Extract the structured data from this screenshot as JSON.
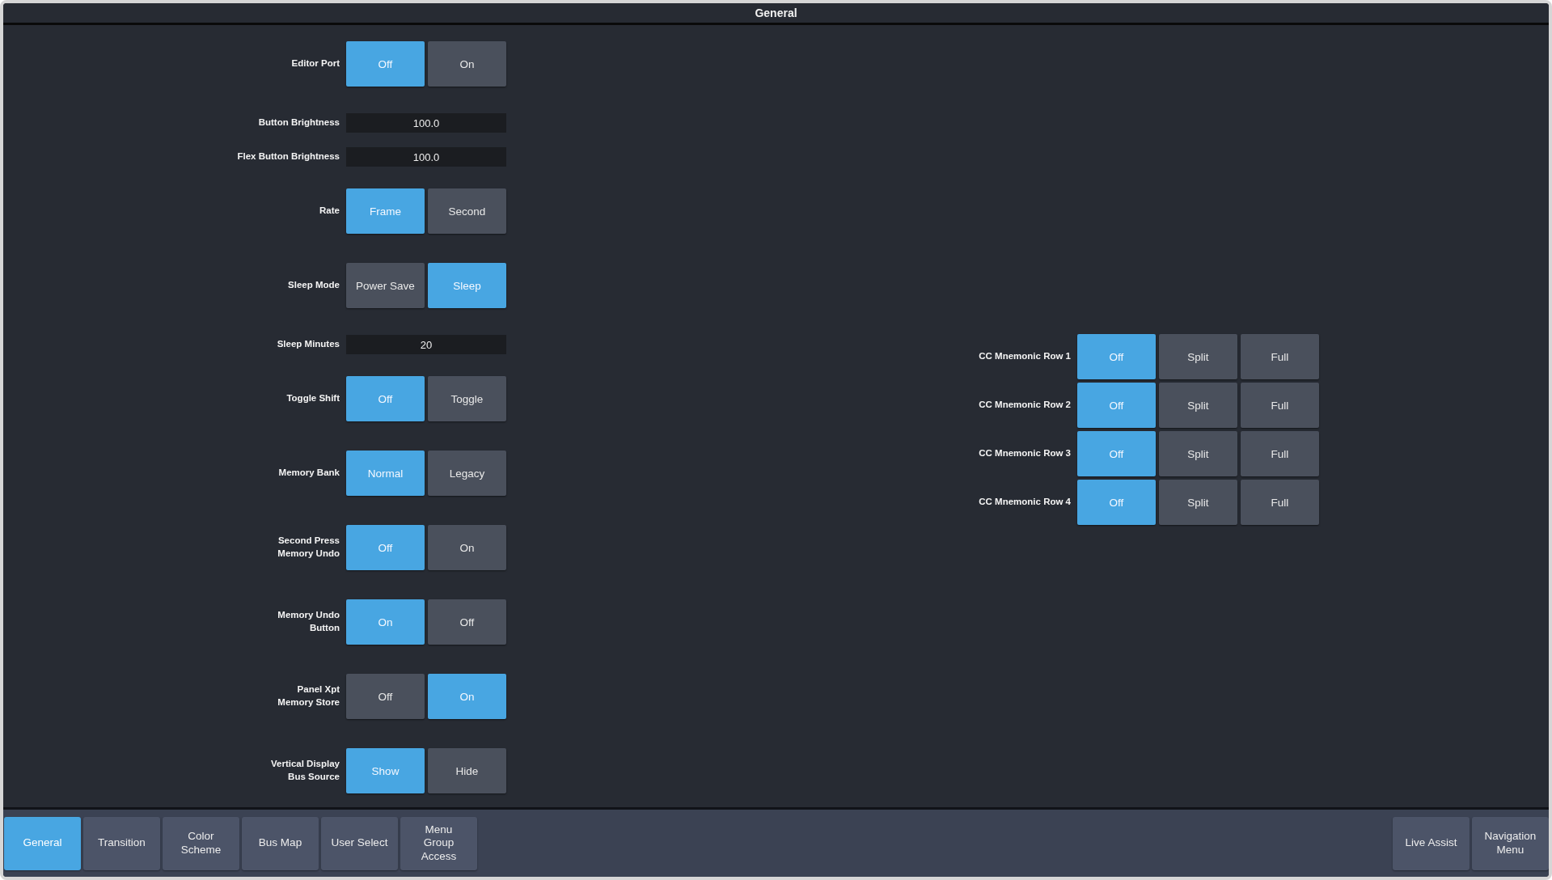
{
  "window": {
    "title": "General"
  },
  "settings": [
    {
      "kind": "toggle",
      "label": "Editor Port",
      "options": [
        {
          "label": "Off",
          "selected": true
        },
        {
          "label": "On",
          "selected": false
        }
      ]
    },
    {
      "kind": "field",
      "label": "Button Brightness",
      "value": "100.0"
    },
    {
      "kind": "field",
      "label": "Flex Button Brightness",
      "value": "100.0"
    },
    {
      "kind": "toggle",
      "label": "Rate",
      "options": [
        {
          "label": "Frame",
          "selected": true
        },
        {
          "label": "Second",
          "selected": false
        }
      ]
    },
    {
      "kind": "toggle",
      "label": "Sleep Mode",
      "options": [
        {
          "label": "Power Save",
          "selected": false
        },
        {
          "label": "Sleep",
          "selected": true
        }
      ]
    },
    {
      "kind": "field",
      "label": "Sleep Minutes",
      "value": "20"
    },
    {
      "kind": "toggle",
      "label": "Toggle Shift",
      "options": [
        {
          "label": "Off",
          "selected": true
        },
        {
          "label": "Toggle",
          "selected": false
        }
      ]
    },
    {
      "kind": "toggle",
      "label": "Memory Bank",
      "options": [
        {
          "label": "Normal",
          "selected": true
        },
        {
          "label": "Legacy",
          "selected": false
        }
      ]
    },
    {
      "kind": "toggle",
      "label": "Second Press\nMemory Undo",
      "options": [
        {
          "label": "Off",
          "selected": true
        },
        {
          "label": "On",
          "selected": false
        }
      ]
    },
    {
      "kind": "toggle",
      "label": "Memory Undo\nButton",
      "options": [
        {
          "label": "On",
          "selected": true
        },
        {
          "label": "Off",
          "selected": false
        }
      ]
    },
    {
      "kind": "toggle",
      "label": "Panel Xpt\nMemory Store",
      "options": [
        {
          "label": "Off",
          "selected": false
        },
        {
          "label": "On",
          "selected": true
        }
      ]
    },
    {
      "kind": "toggle",
      "label": "Vertical Display\nBus Source",
      "options": [
        {
          "label": "Show",
          "selected": true
        },
        {
          "label": "Hide",
          "selected": false
        }
      ]
    }
  ],
  "cc_mnemonic_rows": [
    {
      "label": "CC Mnemonic Row 1",
      "options": [
        {
          "label": "Off",
          "selected": true
        },
        {
          "label": "Split",
          "selected": false
        },
        {
          "label": "Full",
          "selected": false
        }
      ]
    },
    {
      "label": "CC Mnemonic Row 2",
      "options": [
        {
          "label": "Off",
          "selected": true
        },
        {
          "label": "Split",
          "selected": false
        },
        {
          "label": "Full",
          "selected": false
        }
      ]
    },
    {
      "label": "CC Mnemonic Row 3",
      "options": [
        {
          "label": "Off",
          "selected": true
        },
        {
          "label": "Split",
          "selected": false
        },
        {
          "label": "Full",
          "selected": false
        }
      ]
    },
    {
      "label": "CC Mnemonic Row 4",
      "options": [
        {
          "label": "Off",
          "selected": true
        },
        {
          "label": "Split",
          "selected": false
        },
        {
          "label": "Full",
          "selected": false
        }
      ]
    }
  ],
  "bottom_tabs": [
    {
      "label": "General",
      "selected": true
    },
    {
      "label": "Transition",
      "selected": false
    },
    {
      "label": "Color\nScheme",
      "selected": false
    },
    {
      "label": "Bus Map",
      "selected": false
    },
    {
      "label": "User Select",
      "selected": false
    },
    {
      "label": "Menu\nGroup\nAccess",
      "selected": false
    }
  ],
  "right_tabs": [
    {
      "label": "Live Assist",
      "selected": false
    },
    {
      "label": "Navigation\nMenu",
      "selected": false
    }
  ]
}
